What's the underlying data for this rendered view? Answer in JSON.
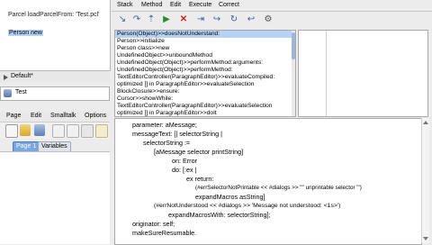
{
  "workspace": {
    "line1": "Parcel loadParcelFrom: 'Test.pcl'",
    "line2": "Person new"
  },
  "package_browser": {
    "default_label": "Default*",
    "test_label": "Test"
  },
  "left_window": {
    "menu": [
      "Page",
      "Edit",
      "Smalltalk",
      "Options"
    ],
    "tabs": [
      "Page 1",
      "Variables"
    ]
  },
  "debugger": {
    "menu": [
      "Stack",
      "Method",
      "Edit",
      "Execute",
      "Correct"
    ],
    "toolbar_icons": [
      "step-into-icon",
      "step-over-icon",
      "step-return-icon",
      "run-icon",
      "terminate-icon",
      "skip-icon",
      "jump-icon",
      "restart-icon",
      "return-icon",
      "debug-icon"
    ],
    "stack_frames": [
      "Person(Object)>>doesNotUnderstand:",
      "Person>>initialize",
      "Person class>>new",
      "UndefinedObject>>unboundMethod",
      "UndefinedObject(Object)>>performMethod:arguments:",
      "UndefinedObject(Object)>>performMethod:",
      "TextEditorController(ParagraphEditor)>>evaluateCompiled:",
      "optimized [] in ParagraphEditor>>evaluateSelection",
      "BlockClosure>>ensure:",
      "Cursor>>showWhile:",
      "TextEditorController(ParagraphEditor)>>evaluateSelection",
      "optimized [] in ParagraphEditor>>doIt"
    ],
    "code_lines": [
      "parameter: aMessage;",
      "messageText: [| selectorString |",
      "selectorString :=",
      "[aMessage selector printString]",
      "on: Error",
      "do: [:ex |",
      "ex return:",
      "(#errSelectorNotPrintable << #dialogs >> '\"' unprintable selector \"')",
      "expandMacros asString]",
      "(#errNotUnderstood << #dialogs >> 'Message not understood: <1s>')",
      "expandMacrosWith: selectorString];",
      "originator: self;",
      "makeSureResumable."
    ]
  }
}
